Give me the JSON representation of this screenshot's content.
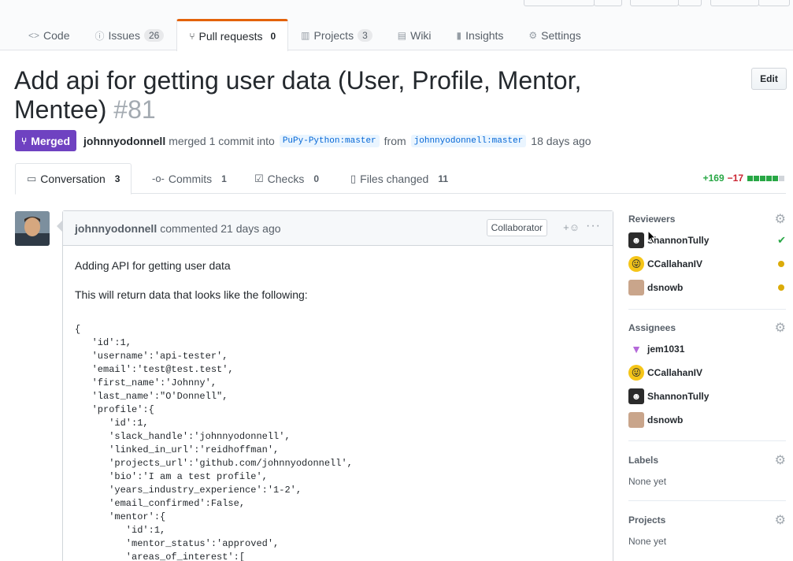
{
  "repo_nav": {
    "tabs": [
      {
        "label": "Code",
        "icon": "code-icon",
        "count": ""
      },
      {
        "label": "Issues",
        "icon": "issue-icon",
        "count": "26"
      },
      {
        "label": "Pull requests",
        "icon": "pull-request-icon",
        "count": "0"
      },
      {
        "label": "Projects",
        "icon": "project-icon",
        "count": "3"
      },
      {
        "label": "Wiki",
        "icon": "book-icon",
        "count": ""
      },
      {
        "label": "Insights",
        "icon": "graph-icon",
        "count": ""
      },
      {
        "label": "Settings",
        "icon": "gear-icon",
        "count": ""
      }
    ]
  },
  "pr": {
    "title": "Add api for getting user data (User, Profile, Mentor, Mentee)",
    "number": "#81",
    "edit_label": "Edit",
    "state": "Merged",
    "author": "johnnyodonnell",
    "merge_text": "merged 1 commit into",
    "base_branch": "PuPy-Python:master",
    "from_text": "from",
    "head_branch": "johnnyodonnell:master",
    "time_ago": "18 days ago"
  },
  "pr_tabs": [
    {
      "label": "Conversation",
      "count": "3",
      "icon": "comment-icon"
    },
    {
      "label": "Commits",
      "count": "1",
      "icon": "commit-icon"
    },
    {
      "label": "Checks",
      "count": "0",
      "icon": "checklist-icon"
    },
    {
      "label": "Files changed",
      "count": "11",
      "icon": "file-diff-icon"
    }
  ],
  "diffstat": {
    "additions": "+169",
    "deletions": "−17",
    "blocks": [
      "#28a745",
      "#28a745",
      "#28a745",
      "#28a745",
      "#28a745",
      "#d1d5da"
    ]
  },
  "comment": {
    "author": "johnnyodonnell",
    "action": "commented 21 days ago",
    "role": "Collaborator",
    "paragraphs": [
      "Adding API for getting user data",
      "This will return data that looks like the following:"
    ],
    "code": "{\n   'id':1,\n   'username':'api-tester',\n   'email':'test@test.test',\n   'first_name':'Johnny',\n   'last_name':\"O'Donnell\",\n   'profile':{\n      'id':1,\n      'slack_handle':'johnnyodonnell',\n      'linked_in_url':'reidhoffman',\n      'projects_url':'github.com/johnnyodonnell',\n      'bio':'I am a test profile',\n      'years_industry_experience':'1-2',\n      'email_confirmed':False,\n      'mentor':{\n         'id':1,\n         'mentor_status':'approved',\n         'areas_of_interest':["
  },
  "sidebar": {
    "reviewers": {
      "title": "Reviewers",
      "people": [
        {
          "name": "ShannonTully",
          "status": "approved"
        },
        {
          "name": "CCallahanIV",
          "status": "pending"
        },
        {
          "name": "dsnowb",
          "status": "pending"
        }
      ]
    },
    "assignees": {
      "title": "Assignees",
      "people": [
        "jem1031",
        "CCallahanIV",
        "ShannonTully",
        "dsnowb"
      ]
    },
    "labels": {
      "title": "Labels",
      "value": "None yet"
    },
    "projects": {
      "title": "Projects",
      "value": "None yet"
    }
  }
}
